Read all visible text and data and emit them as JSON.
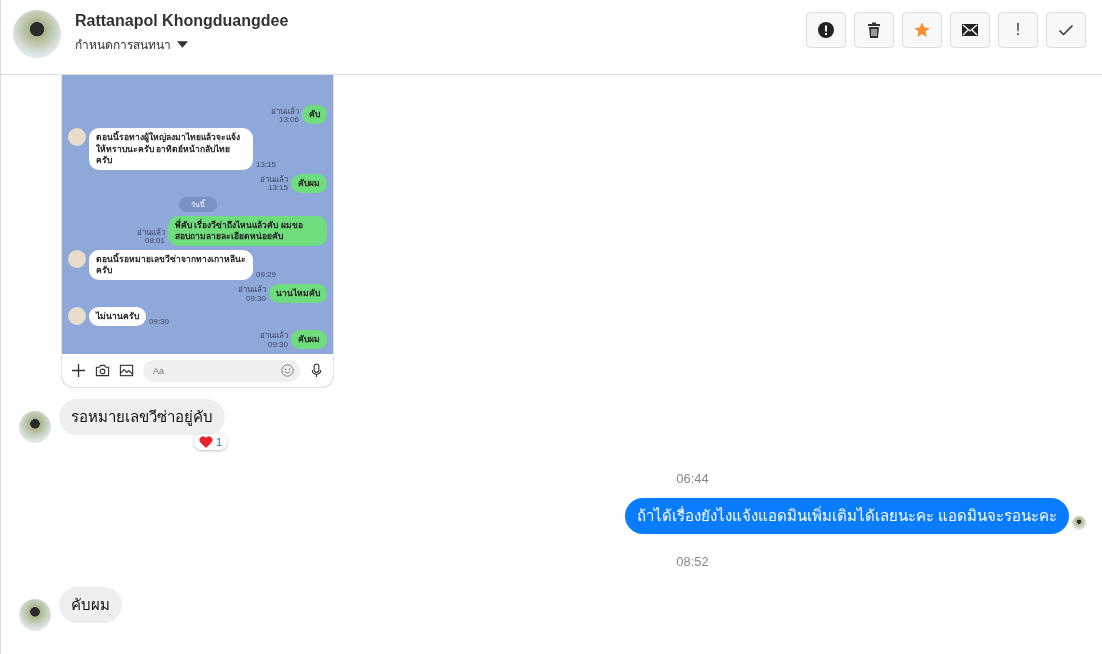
{
  "header": {
    "name": "Rattanapol Khongduangdee",
    "subtitle": "กำหนดการสนทนา"
  },
  "toolbar": [
    {
      "kind": "alert"
    },
    {
      "kind": "trash"
    },
    {
      "kind": "star"
    },
    {
      "kind": "mail"
    },
    {
      "kind": "text",
      "label": "!"
    },
    {
      "kind": "check"
    }
  ],
  "messages": [
    {
      "kind": "image",
      "chat": {
        "placeholder": "Aa",
        "items": [
          {
            "kind": "out",
            "text": "คับ",
            "read": "อ่านแล้ว",
            "time": "13:06"
          },
          {
            "kind": "in",
            "text": "ตอนนี้รอทางผู้ใหญ่ลงมาไทยแล้วจะแจ้งให้ทราบนะครับ อาทิตย์หน้ากลับไทยครับ",
            "time": "13:15"
          },
          {
            "kind": "out",
            "text": "คับผม",
            "read": "อ่านแล้ว",
            "time": "13:15"
          },
          {
            "kind": "date",
            "text": "วันนี้"
          },
          {
            "kind": "out",
            "text": "พี่คับ เรื่องวีซ่าถึงไหนแล้วคับ ผมขอสอบถามลายละเอียดหน่อยคับ",
            "read": "อ่านแล้ว",
            "time": "08:01"
          },
          {
            "kind": "in",
            "text": "ตอนนี้รอหมายเลขวีซ่าจากทางเกาหลีนะครับ",
            "time": "09:29"
          },
          {
            "kind": "out",
            "text": "นานไหมคับ",
            "read": "อ่านแล้ว",
            "time": "09:30"
          },
          {
            "kind": "in",
            "text": "ไม่นานครับ",
            "time": "09:30"
          },
          {
            "kind": "out",
            "text": "คับผม",
            "read": "อ่านแล้ว",
            "time": "09:30"
          }
        ]
      }
    },
    {
      "kind": "in",
      "text": "รอหมายเลขวีซ่าอยู่คับ",
      "reaction": {
        "count": "1"
      }
    },
    {
      "kind": "time",
      "text": "06:44"
    },
    {
      "kind": "out",
      "text": "ถ้าได้เรื่องยังไงแจ้งแอดมินเพิ่มเติมได้เลยนะคะ แอดมินจะรอนะคะ"
    },
    {
      "kind": "time",
      "text": "08:52"
    },
    {
      "kind": "in",
      "text": "คับผม"
    }
  ]
}
